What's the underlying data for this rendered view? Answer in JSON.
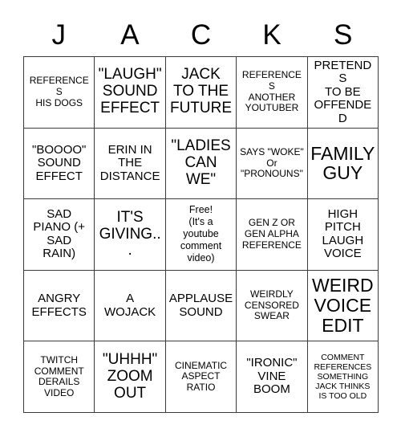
{
  "card": {
    "title_letters": [
      "J",
      "A",
      "C",
      "K",
      "S"
    ],
    "columns": 5,
    "rows": 5,
    "colors": {
      "background": "#ffffff",
      "border": "#3b3b3b",
      "text": "#000000"
    },
    "cells": [
      [
        {
          "text": "REFERENCES\nHIS DOGS",
          "size": "fs-sm",
          "free": false
        },
        {
          "text": "\"LAUGH\"\nSOUND\nEFFECT",
          "size": "fs-lg",
          "free": false
        },
        {
          "text": "JACK\nTO THE\nFUTURE",
          "size": "fs-lg",
          "free": false
        },
        {
          "text": "REFERENCES\nANOTHER\nYOUTUBER",
          "size": "fs-sm",
          "free": false
        },
        {
          "text": "PRETENDS\nTO BE\nOFFENDED",
          "size": "fs-md",
          "free": false
        }
      ],
      [
        {
          "text": "\"BOOOO\"\nSOUND\nEFFECT",
          "size": "fs-md",
          "free": false
        },
        {
          "text": "ERIN IN\nTHE\nDISTANCE",
          "size": "fs-md",
          "free": false
        },
        {
          "text": "\"LADIES\nCAN\nWE\"",
          "size": "fs-lg",
          "free": false
        },
        {
          "text": "SAYS \"WOKE\"\nOr\n\"PRONOUNS\"",
          "size": "fs-sm",
          "free": false
        },
        {
          "text": "FAMILY\nGUY",
          "size": "fs-xl",
          "free": false
        }
      ],
      [
        {
          "text": "SAD\nPIANO (+\nSAD\nRAIN)",
          "size": "fs-md",
          "free": false
        },
        {
          "text": "IT'S\nGIVING...",
          "size": "fs-lg",
          "free": false
        },
        {
          "text": "Free!\n(It's a\nyoutube\ncomment\nvideo)",
          "size": "fs-sm",
          "free": true
        },
        {
          "text": "GEN Z OR\nGEN ALPHA\nREFERENCE",
          "size": "fs-sm",
          "free": false
        },
        {
          "text": "HIGH\nPITCH\nLAUGH\nVOICE",
          "size": "fs-md",
          "free": false
        }
      ],
      [
        {
          "text": "ANGRY\nEFFECTS",
          "size": "fs-md",
          "free": false
        },
        {
          "text": "A\nWOJACK",
          "size": "fs-md",
          "free": false
        },
        {
          "text": "APPLAUSE\nSOUND",
          "size": "fs-md",
          "free": false
        },
        {
          "text": "WEIRDLY\nCENSORED\nSWEAR",
          "size": "fs-sm",
          "free": false
        },
        {
          "text": "WEIRD\nVOICE\nEDIT",
          "size": "fs-xl",
          "free": false
        }
      ],
      [
        {
          "text": "TWITCH\nCOMMENT\nDERAILS\nVIDEO",
          "size": "fs-sm",
          "free": false
        },
        {
          "text": "\"UHHH\"\nZOOM\nOUT",
          "size": "fs-lg",
          "free": false
        },
        {
          "text": "CINEMATIC\nASPECT\nRATIO",
          "size": "fs-sm",
          "free": false
        },
        {
          "text": "\"IRONIC\"\nVINE\nBOOM",
          "size": "fs-md",
          "free": false
        },
        {
          "text": "COMMENT\nREFERENCES\nSOMETHING\nJACK THINKS\nIS TOO OLD",
          "size": "fs-xs",
          "free": false
        }
      ]
    ]
  }
}
